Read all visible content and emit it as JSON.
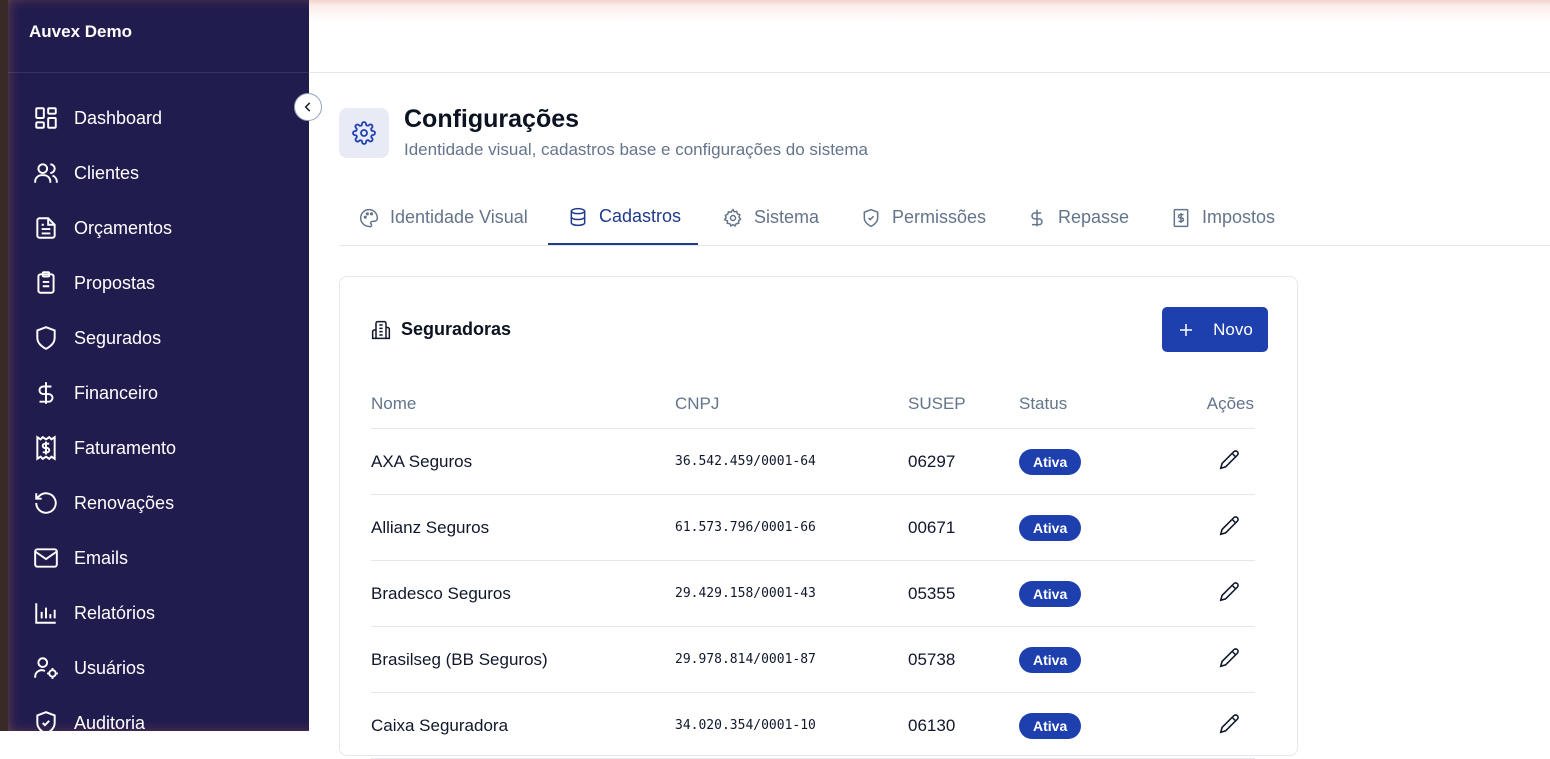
{
  "app": {
    "brand": "Auvex Demo"
  },
  "sidebar": {
    "items": [
      {
        "label": "Dashboard",
        "icon": "dashboard-icon"
      },
      {
        "label": "Clientes",
        "icon": "users-icon"
      },
      {
        "label": "Orçamentos",
        "icon": "file-text-icon"
      },
      {
        "label": "Propostas",
        "icon": "clipboard-icon"
      },
      {
        "label": "Segurados",
        "icon": "shield-icon"
      },
      {
        "label": "Financeiro",
        "icon": "dollar-icon"
      },
      {
        "label": "Faturamento",
        "icon": "receipt-icon"
      },
      {
        "label": "Renovações",
        "icon": "rotate-icon"
      },
      {
        "label": "Emails",
        "icon": "mail-icon"
      },
      {
        "label": "Relatórios",
        "icon": "bar-chart-icon"
      },
      {
        "label": "Usuários",
        "icon": "user-cog-icon"
      },
      {
        "label": "Auditoria",
        "icon": "shield-check-icon"
      }
    ]
  },
  "header": {
    "title": "Configurações",
    "subtitle": "Identidade visual, cadastros base e configurações do sistema",
    "icon": "gear-icon"
  },
  "tabs": [
    {
      "label": "Identidade Visual",
      "icon": "palette-icon"
    },
    {
      "label": "Cadastros",
      "icon": "database-icon",
      "active": true
    },
    {
      "label": "Sistema",
      "icon": "gear-icon"
    },
    {
      "label": "Permissões",
      "icon": "shield-check-icon"
    },
    {
      "label": "Repasse",
      "icon": "dollar-icon"
    },
    {
      "label": "Impostos",
      "icon": "receipt-icon"
    }
  ],
  "card": {
    "title": "Seguradoras",
    "new_button": "Novo",
    "columns": [
      "Nome",
      "CNPJ",
      "SUSEP",
      "Status",
      "Ações"
    ],
    "rows": [
      {
        "nome": "AXA Seguros",
        "cnpj": "36.542.459/0001-64",
        "susep": "06297",
        "status": "Ativa"
      },
      {
        "nome": "Allianz Seguros",
        "cnpj": "61.573.796/0001-66",
        "susep": "00671",
        "status": "Ativa"
      },
      {
        "nome": "Bradesco Seguros",
        "cnpj": "29.429.158/0001-43",
        "susep": "05355",
        "status": "Ativa"
      },
      {
        "nome": "Brasilseg (BB Seguros)",
        "cnpj": "29.978.814/0001-87",
        "susep": "05738",
        "status": "Ativa"
      },
      {
        "nome": "Caixa Seguradora",
        "cnpj": "34.020.354/0001-10",
        "susep": "06130",
        "status": "Ativa"
      }
    ]
  },
  "colors": {
    "sidebar_bg": "#211c4e",
    "accent": "#1e40af",
    "tab_active": "#1e3a8a",
    "muted_text": "#64748b"
  }
}
